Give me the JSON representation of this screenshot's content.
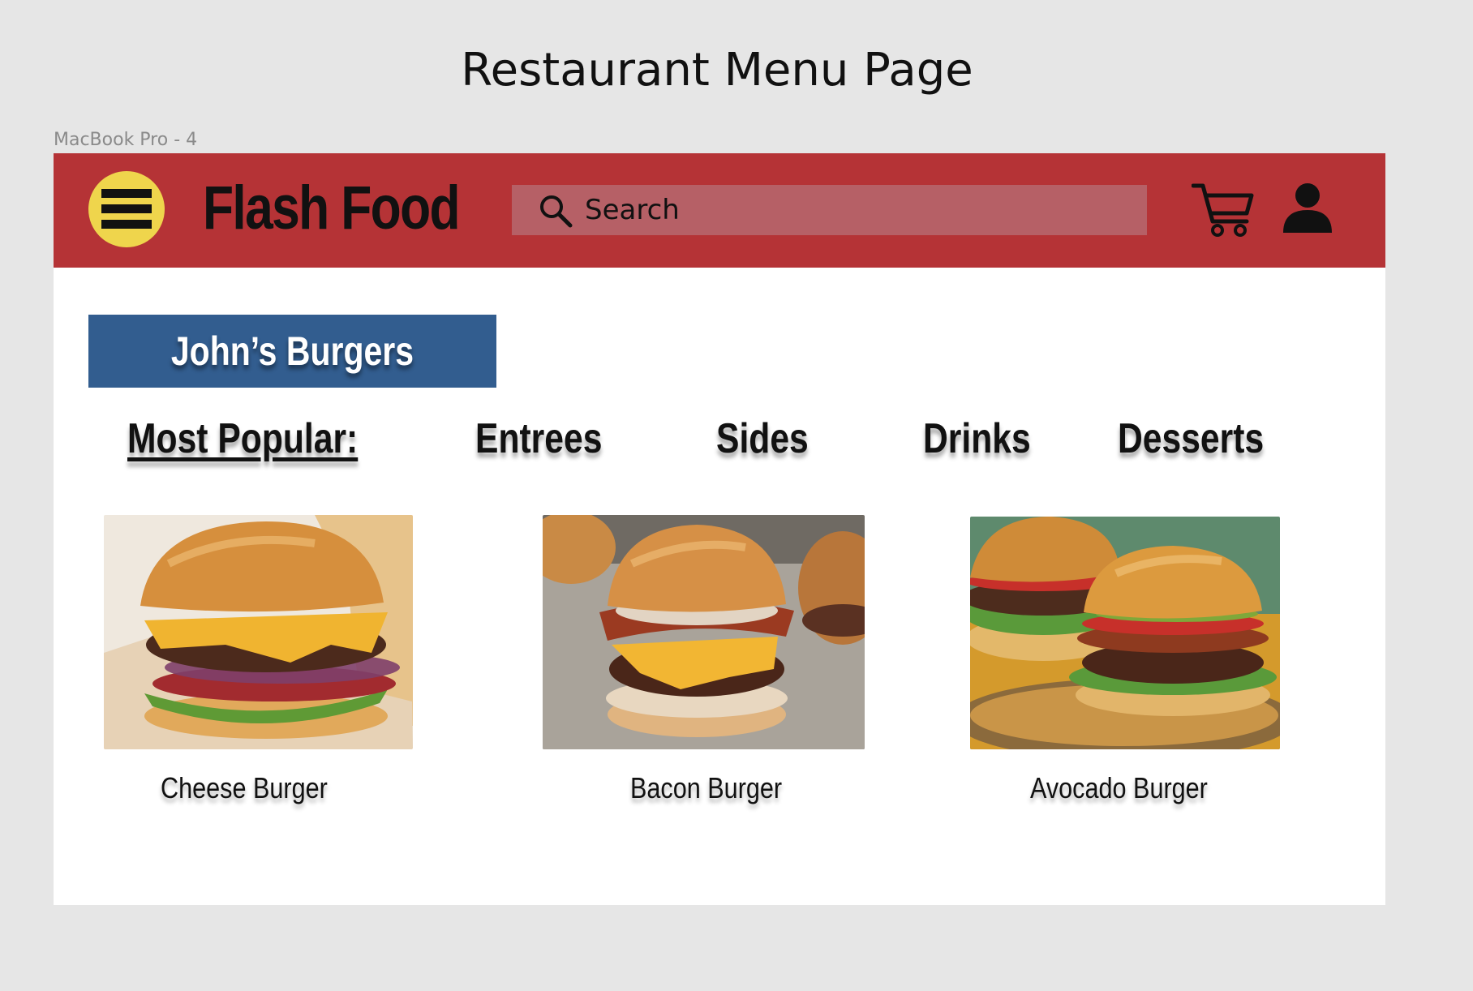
{
  "page_title": "Restaurant Menu Page",
  "frame_label": "MacBook Pro - 4",
  "header": {
    "brand": "Flash Food",
    "search_placeholder": "Search",
    "colors": {
      "header_bg": "#b53336",
      "menu_button": "#efd54c",
      "search_bg": "#b66066"
    }
  },
  "restaurant": {
    "name": "John’s Burgers",
    "banner_color": "#325d8f"
  },
  "tabs": [
    {
      "label": "Most Popular:",
      "active": true
    },
    {
      "label": "Entrees",
      "active": false
    },
    {
      "label": "Sides",
      "active": false
    },
    {
      "label": "Drinks",
      "active": false
    },
    {
      "label": "Desserts",
      "active": false
    }
  ],
  "items": [
    {
      "name": "Cheese Burger",
      "image": "cheese-burger-photo"
    },
    {
      "name": "Bacon Burger",
      "image": "bacon-burger-photo"
    },
    {
      "name": "Avocado Burger",
      "image": "avocado-burger-photo"
    }
  ],
  "icons": [
    "hamburger-menu-icon",
    "search-icon",
    "cart-icon",
    "user-icon"
  ]
}
